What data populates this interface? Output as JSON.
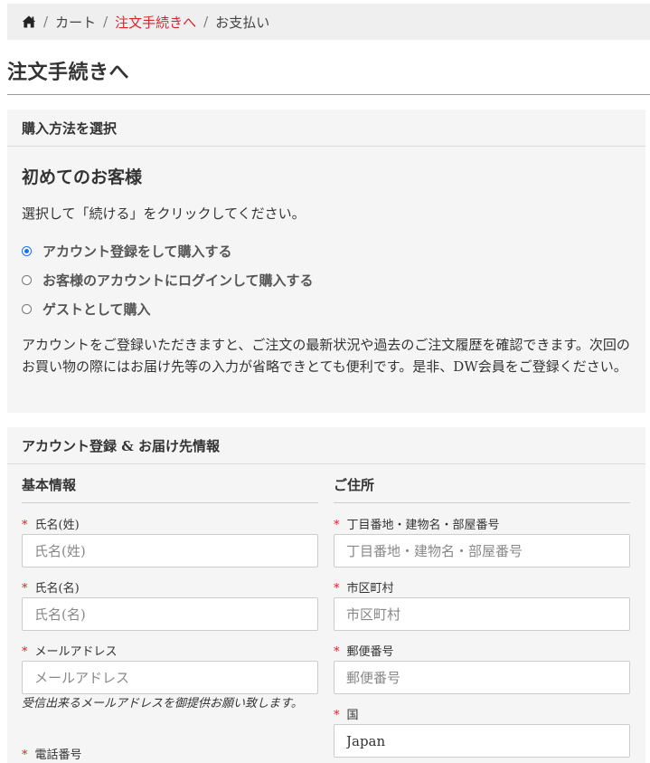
{
  "breadcrumb": {
    "items": [
      "カート",
      "注文手続きへ",
      "お支払い"
    ],
    "separator": "/"
  },
  "page": {
    "title": "注文手続きへ"
  },
  "purchase_method": {
    "heading": "購入方法を選択",
    "subtitle": "初めてのお客様",
    "instruction": "選択して「続ける」をクリックしてください。",
    "options": [
      {
        "label": "アカウント登録をして購入する",
        "checked": true
      },
      {
        "label": "お客様のアカウントにログインして購入する",
        "checked": false
      },
      {
        "label": "ゲストとして購入",
        "checked": false
      }
    ],
    "description": "アカウントをご登録いただきますと、ご注文の最新状況や過去のご注文履歴を確認できます。次回のお買い物の際にはお届け先等の入力が省略できとても便利です。是非、DW会員をご登録ください。"
  },
  "registration": {
    "heading": "アカウント登録 & お届け先情報",
    "basic": {
      "title": "基本情報",
      "last_name": {
        "label": "氏名(姓)",
        "placeholder": "氏名(姓)"
      },
      "first_name": {
        "label": "氏名(名)",
        "placeholder": "氏名(名)"
      },
      "email": {
        "label": "メールアドレス",
        "placeholder": "メールアドレス",
        "help": "受信出来るメールアドレスを御提供お願い致します。"
      },
      "phone": {
        "label": "電話番号"
      }
    },
    "address": {
      "title": "ご住所",
      "street": {
        "label": "丁目番地・建物名・部屋番号",
        "placeholder": "丁目番地・建物名・部屋番号"
      },
      "city": {
        "label": "市区町村",
        "placeholder": "市区町村"
      },
      "postal": {
        "label": "郵便番号",
        "placeholder": "郵便番号"
      },
      "country": {
        "label": "国",
        "value": "Japan"
      }
    },
    "required_mark": "*"
  },
  "colors": {
    "accent": "#d9262c",
    "radio": "#1a73e8"
  }
}
